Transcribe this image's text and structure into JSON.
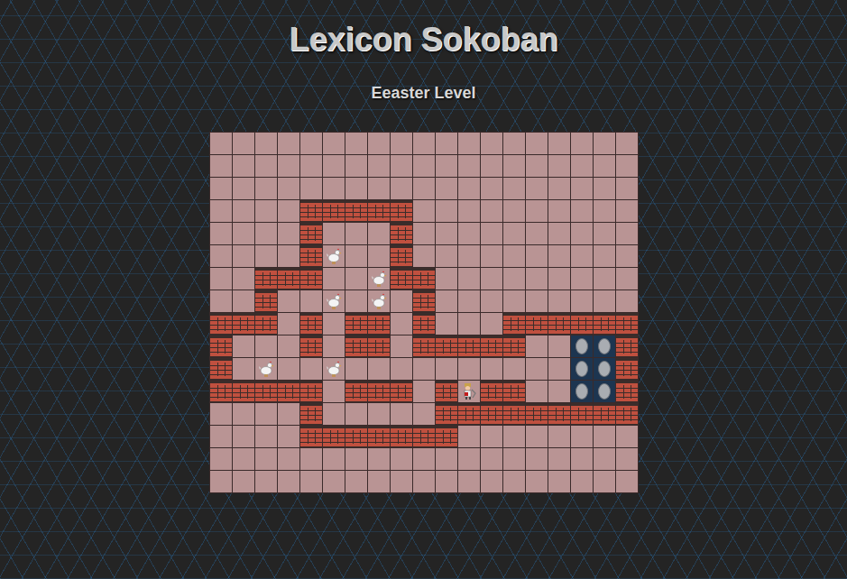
{
  "title": "Lexicon Sokoban",
  "subtitle": "Eeaster Level",
  "grid": {
    "rows": [
      "...................",
      "...................",
      "...................",
      "....#####..........",
      "....#...#..........",
      "....#c..#..........",
      "..###..c##.........",
      "..#..c.c.#.........",
      "###.#.##.#...######",
      "#...#.##.#####..gg#",
      "#.c..c..........gg#",
      "#####.###.#p##..gg#",
      "....#.....#########",
      "....#######........",
      "...................",
      "..................."
    ]
  }
}
